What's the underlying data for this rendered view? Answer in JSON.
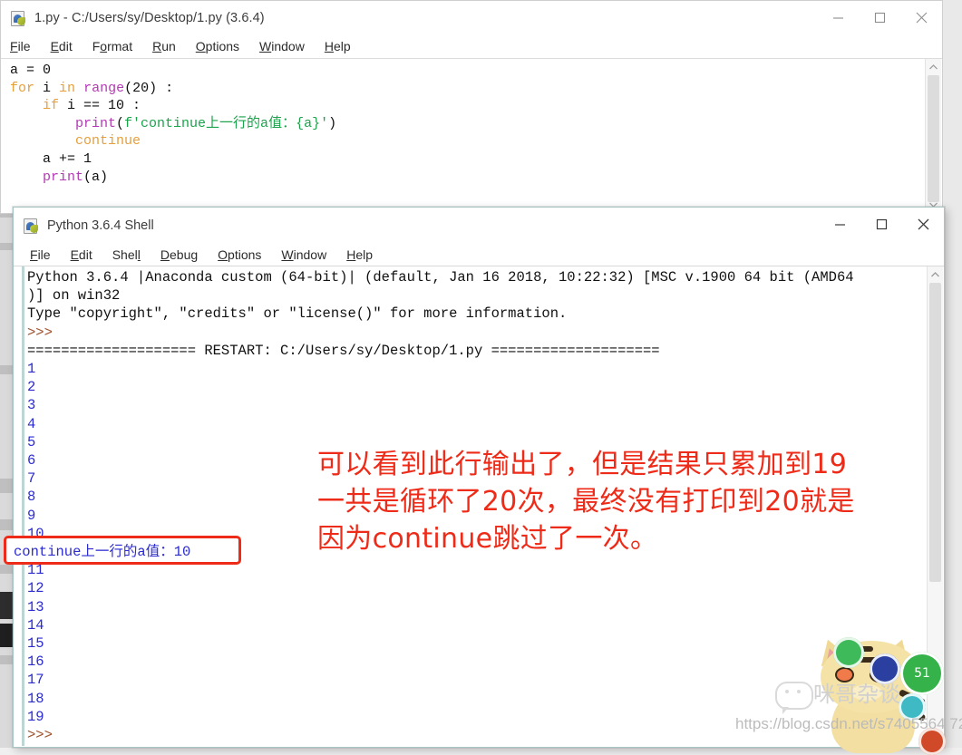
{
  "editor_window": {
    "icon": "python-file-icon",
    "title": "1.py - C:/Users/sy/Desktop/1.py (3.6.4)",
    "menus": [
      {
        "label": "File",
        "accel": "F"
      },
      {
        "label": "Edit",
        "accel": "E"
      },
      {
        "label": "Format",
        "accel": "o"
      },
      {
        "label": "Run",
        "accel": "R"
      },
      {
        "label": "Options",
        "accel": "O"
      },
      {
        "label": "Window",
        "accel": "W"
      },
      {
        "label": "Help",
        "accel": "H"
      }
    ],
    "controls": {
      "minimize": "minimize-icon",
      "maximize": "maximize-icon",
      "close": "close-icon"
    },
    "code_lines": [
      "a = 0",
      "for i in range(20) :",
      "    if i == 10 :",
      "        print(f'continue上一行的a值：{a}')",
      "        continue",
      "    a += 1",
      "    print(a)"
    ],
    "syntax_colors": {
      "keyword": "#e59f3d",
      "builtin": "#b33ab3",
      "string": "#1aa34a",
      "plain": "#111111"
    }
  },
  "shell_window": {
    "icon": "python-shell-icon",
    "title": "Python 3.6.4 Shell",
    "menus": [
      {
        "label": "File",
        "accel": "F"
      },
      {
        "label": "Edit",
        "accel": "E"
      },
      {
        "label": "Shell",
        "accel": "l"
      },
      {
        "label": "Debug",
        "accel": "D"
      },
      {
        "label": "Options",
        "accel": "O"
      },
      {
        "label": "Window",
        "accel": "W"
      },
      {
        "label": "Help",
        "accel": "H"
      }
    ],
    "controls": {
      "minimize": "minimize-icon",
      "maximize": "maximize-icon",
      "close": "close-icon"
    },
    "banner_line_1": "Python 3.6.4 |Anaconda custom (64-bit)| (default, Jan 16 2018, 10:22:32) [MSC v.1900 64 bit (AMD64",
    "banner_line_2": ")] on win32",
    "banner_line_3": "Type \"copyright\", \"credits\" or \"license()\" for more information.",
    "prompt": ">>>",
    "restart_line": "==================== RESTART: C:/Users/sy/Desktop/1.py ====================",
    "output_before": [
      "1",
      "2",
      "3",
      "4",
      "5",
      "6",
      "7",
      "8",
      "9",
      "10"
    ],
    "highlighted_output": "continue上一行的a值：10",
    "output_after": [
      "11",
      "12",
      "13",
      "14",
      "15",
      "16",
      "17",
      "18",
      "19"
    ],
    "final_prompt": ">>>",
    "output_color": "#2b2bd0",
    "prompt_color": "#a0522d"
  },
  "annotation": {
    "text": "可以看到此行输出了，但是结果只累加到19\n一共是循环了20次，最终没有打印到20就是\n因为continue跳过了一次。",
    "color": "#ee2b18",
    "box_color": "#ee2b18"
  },
  "watermark": {
    "brand": "咪哥杂谈",
    "url": "https://blog.csdn.net/s7405564 72",
    "badge_green_text": "51",
    "icons": [
      "wechat-icon",
      "cat-mascot"
    ]
  }
}
